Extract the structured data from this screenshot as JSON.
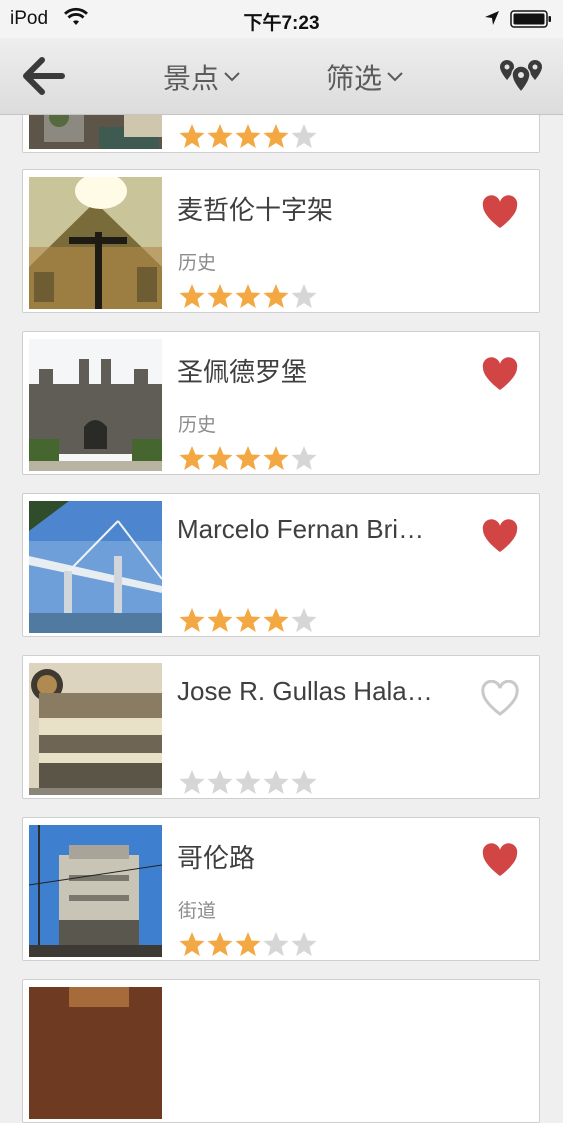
{
  "status_bar": {
    "carrier": "iPod",
    "time": "下午7:23"
  },
  "nav": {
    "back_icon": "back-arrow-icon",
    "menu_category": "景点",
    "menu_filter": "筛选",
    "map_icon": "map-pins-icon"
  },
  "colors": {
    "star_on": "#f3a844",
    "star_off": "#d6d6d6",
    "heart_on": "#d24545",
    "heart_off": "#c9c9c9"
  },
  "items": [
    {
      "title": "",
      "category": "",
      "rating": 4,
      "favorite": null
    },
    {
      "title": "麦哲伦十字架",
      "category": "历史",
      "rating": 4,
      "favorite": true
    },
    {
      "title": "圣佩德罗堡",
      "category": "历史",
      "rating": 4,
      "favorite": true
    },
    {
      "title": "Marcelo Fernan Bri…",
      "category": "",
      "rating": 4,
      "favorite": true
    },
    {
      "title": "Jose R. Gullas Hala…",
      "category": "",
      "rating": 0,
      "favorite": false
    },
    {
      "title": "哥伦路",
      "category": "街道",
      "rating": 3,
      "favorite": true
    }
  ]
}
